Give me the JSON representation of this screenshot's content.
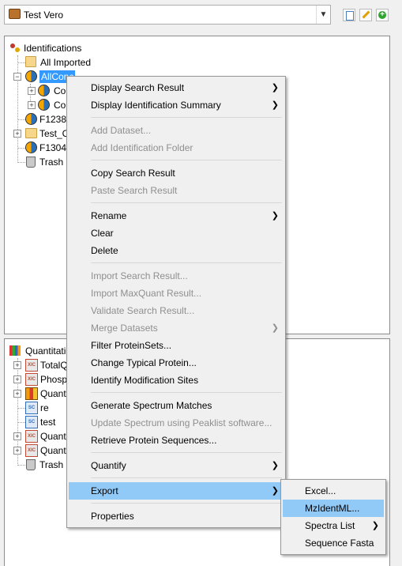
{
  "project_selector": {
    "value": "Test Vero"
  },
  "toolbar": {
    "buttons": [
      "new-document-icon",
      "edit-pencil-icon",
      "add-green-icon"
    ]
  },
  "identification_tree": {
    "root": "Identifications",
    "items": [
      "All Imported",
      "AllConc",
      "Co",
      "Co",
      "F1238",
      "Test_C",
      "F1304",
      "Trash"
    ]
  },
  "quantitation_tree": {
    "root": "Quantitatio",
    "items": [
      "TotalQ",
      "Phosph",
      "Quant",
      "re",
      "test",
      "Quant",
      "Quant",
      "Trash"
    ]
  },
  "context_menu": {
    "items": [
      {
        "label": "Display Search Result",
        "enabled": true,
        "submenu": true
      },
      {
        "label": "Display Identification Summary",
        "enabled": true,
        "submenu": true
      },
      {
        "label": "Add Dataset...",
        "enabled": false
      },
      {
        "label": "Add Identification Folder",
        "enabled": false
      },
      {
        "label": "Copy Search Result",
        "enabled": true
      },
      {
        "label": "Paste Search Result",
        "enabled": false
      },
      {
        "label": "Rename",
        "enabled": true,
        "submenu": true
      },
      {
        "label": "Clear",
        "enabled": true
      },
      {
        "label": "Delete",
        "enabled": true
      },
      {
        "label": "Import Search Result...",
        "enabled": false
      },
      {
        "label": "Import MaxQuant Result...",
        "enabled": false
      },
      {
        "label": "Validate Search Result...",
        "enabled": false
      },
      {
        "label": "Merge Datasets",
        "enabled": false,
        "submenu": true
      },
      {
        "label": "Filter ProteinSets...",
        "enabled": true
      },
      {
        "label": "Change Typical Protein...",
        "enabled": true
      },
      {
        "label": "Identify Modification Sites",
        "enabled": true
      },
      {
        "label": "Generate Spectrum Matches",
        "enabled": true
      },
      {
        "label": "Update Spectrum using Peaklist software...",
        "enabled": false
      },
      {
        "label": "Retrieve Protein Sequences...",
        "enabled": true
      },
      {
        "label": "Quantify",
        "enabled": true,
        "submenu": true
      },
      {
        "label": "Export",
        "enabled": true,
        "submenu": true,
        "highlighted": true
      },
      {
        "label": "Properties",
        "enabled": true
      }
    ]
  },
  "export_submenu": {
    "items": [
      {
        "label": "Excel...",
        "enabled": true
      },
      {
        "label": "MzIdentML...",
        "enabled": true,
        "highlighted": true
      },
      {
        "label": "Spectra List",
        "enabled": true,
        "submenu": true
      },
      {
        "label": "Sequence Fasta",
        "enabled": true
      }
    ]
  },
  "colors": {
    "highlight": "#91c9f7",
    "selection": "#3399ff",
    "disabled_text": "#8f8f8f"
  }
}
